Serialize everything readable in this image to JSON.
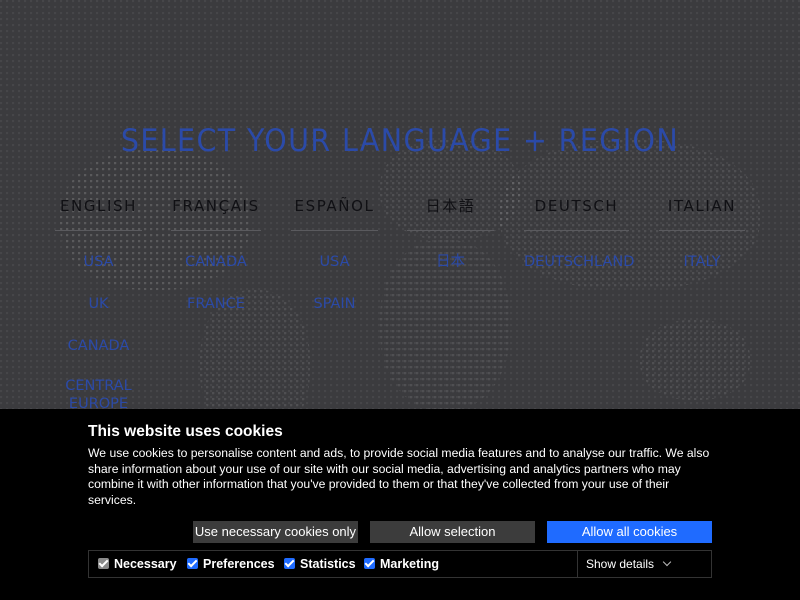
{
  "headline": "SELECT YOUR LANGUAGE + REGION",
  "languages": [
    {
      "name": "ENGLISH",
      "regions": [
        "USA",
        "UK",
        "CANADA",
        "CENTRAL",
        "EUROPE"
      ]
    },
    {
      "name": "FRANÇAIS",
      "regions": [
        "CANADA",
        "FRANCE"
      ]
    },
    {
      "name": "ESPAÑOL",
      "regions": [
        "USA",
        "SPAIN"
      ]
    },
    {
      "name": "日本語",
      "regions": [
        "日本"
      ]
    },
    {
      "name": "DEUTSCH",
      "regions": [
        "DEUTSCHLAND"
      ]
    },
    {
      "name": "ITALIAN",
      "regions": [
        "ITALY"
      ]
    }
  ],
  "cookie": {
    "title": "This website uses cookies",
    "text": "We use cookies to personalise content and ads, to provide social media features and to analyse our traffic. We also share information about your use of our site with our social media, advertising and analytics partners who may combine it with other information that you've provided to them or that they've collected from your use of their services.",
    "btn_necessary": "Use necessary cookies only",
    "btn_selection": "Allow selection",
    "btn_allow_all": "Allow all cookies",
    "options": {
      "necessary": "Necessary",
      "preferences": "Preferences",
      "statistics": "Statistics",
      "marketing": "Marketing"
    },
    "show_details": "Show details"
  },
  "colors": {
    "accent": "#2b4aa8",
    "allow_all": "#1f6bff"
  }
}
